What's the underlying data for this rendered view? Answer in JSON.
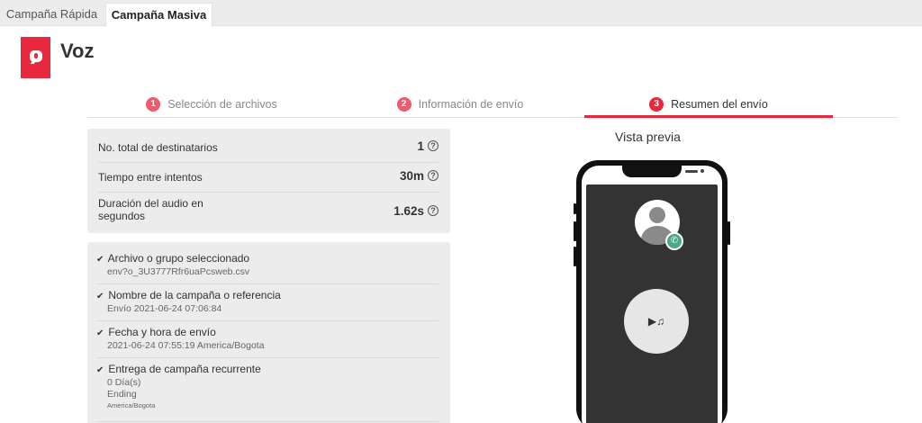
{
  "tabs": [
    {
      "label": "Campaña Rápida",
      "active": false
    },
    {
      "label": "Campaña Masiva",
      "active": true
    }
  ],
  "header": {
    "title": "Voz",
    "logo_icon": "voice-message-icon",
    "brand_color": "#e8283c"
  },
  "steps": [
    {
      "number": "1",
      "label": "Selección de archivos",
      "active": false
    },
    {
      "number": "2",
      "label": "Información de envío",
      "active": false
    },
    {
      "number": "3",
      "label": "Resumen del envío",
      "active": true
    }
  ],
  "summary": {
    "rows": [
      {
        "label": "No. total de destinatarios",
        "value": "1",
        "help_icon": "?"
      },
      {
        "label": "Tiempo entre intentos",
        "value": "30m",
        "help_icon": "?"
      },
      {
        "label": "Duración del audio en segundos",
        "value": "1.62s",
        "help_icon": "?"
      }
    ]
  },
  "details": [
    {
      "title": "Archivo o grupo seleccionado",
      "lines": [
        "env?o_3U3777Rfr6uaPcsweb.csv"
      ]
    },
    {
      "title": "Nombre de la campaña o referencia",
      "lines": [
        "Envío 2021-06-24 07:06:84"
      ]
    },
    {
      "title": "Fecha y hora de envío",
      "lines": [
        "2021-06-24 07:55:19 America/Bogota"
      ]
    },
    {
      "title": "Entrega de campaña recurrente",
      "lines": [
        "0 Día(s)",
        "Ending"
      ],
      "small": "America/Bogota"
    }
  ],
  "check_glyph": "✔",
  "preview": {
    "title": "Vista previa",
    "call_glyph": "✆",
    "play_glyph": "▶♫"
  }
}
